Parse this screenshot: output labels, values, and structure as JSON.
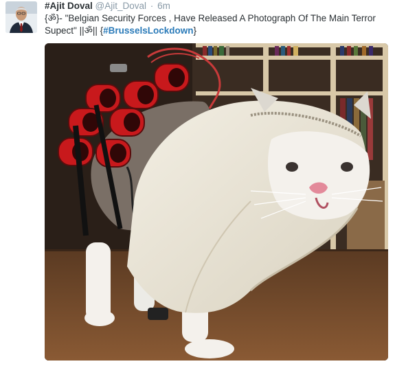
{
  "tweet": {
    "name": "#Ajit Doval",
    "handle": "@Ajit_Doval",
    "separator": "·",
    "time": "6m",
    "text_line": "{ॐ}- \"Belgian Security Forces , Have Released A Photograph Of The Main Terror Supect\" ||ॐ|| {",
    "hashtag": "#BrusselsLockdown",
    "text_close": "}"
  },
  "icons": {
    "avatar": "profile-photo",
    "media": "cat-in-costume-photo"
  },
  "colors": {
    "text": "#292f33",
    "meta": "#8899a6",
    "link": "#2b7bb9"
  }
}
